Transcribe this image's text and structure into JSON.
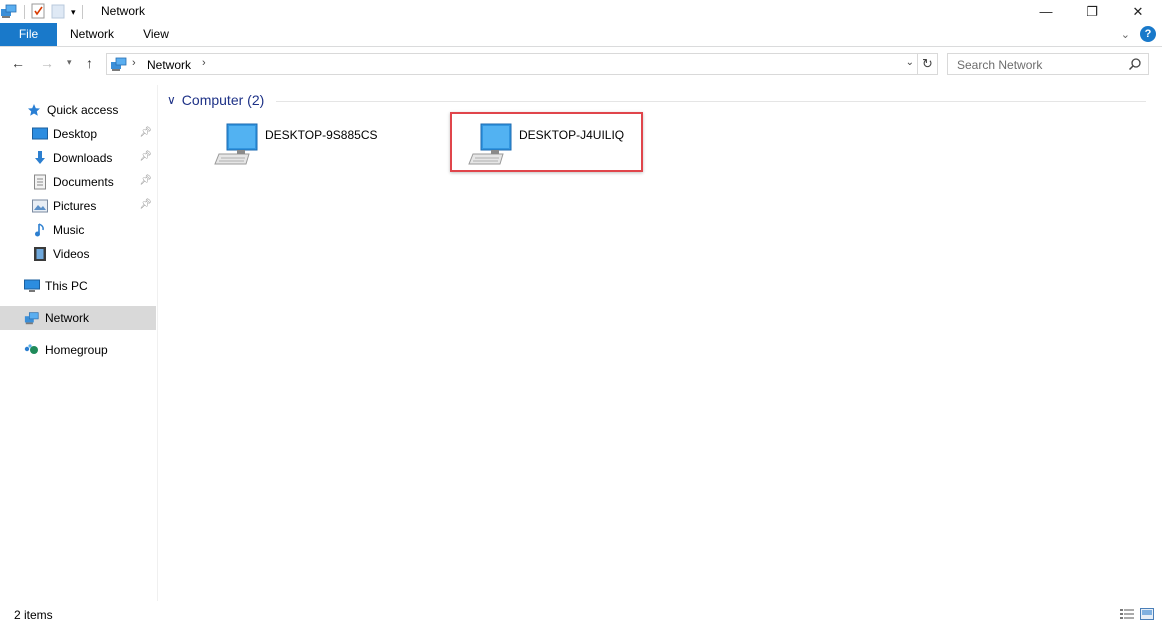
{
  "title_bar": {
    "title": "Network",
    "quick_access_icons": [
      "network-icon",
      "properties-icon",
      "new-folder-icon",
      "customize-dropdown-icon"
    ],
    "controls": {
      "minimize": "—",
      "maximize": "❐",
      "close": "✕"
    }
  },
  "ribbon": {
    "tabs": [
      {
        "label": "File",
        "active": true
      },
      {
        "label": "Network"
      },
      {
        "label": "View"
      }
    ],
    "help": "?",
    "accent_color": "#1979ca"
  },
  "address_bar": {
    "path": [
      "Network"
    ],
    "search_placeholder": "Search Network"
  },
  "sidebar": {
    "quick_access": "Quick access",
    "quick_items": [
      {
        "label": "Desktop",
        "icon": "desktop-icon",
        "pinned": true
      },
      {
        "label": "Downloads",
        "icon": "downloads-icon",
        "pinned": true
      },
      {
        "label": "Documents",
        "icon": "documents-icon",
        "pinned": true
      },
      {
        "label": "Pictures",
        "icon": "pictures-icon",
        "pinned": true
      },
      {
        "label": "Music",
        "icon": "music-icon",
        "pinned": false
      },
      {
        "label": "Videos",
        "icon": "videos-icon",
        "pinned": false
      }
    ],
    "this_pc": "This PC",
    "network": "Network",
    "homegroup": "Homegroup"
  },
  "content": {
    "group_label": "Computer (2)",
    "items": [
      {
        "name": "DESKTOP-9S885CS"
      },
      {
        "name": "DESKTOP-J4UILIQ",
        "highlighted": true
      }
    ],
    "highlight_color": "#e0454b"
  },
  "status_bar": {
    "item_count": "2 items"
  }
}
